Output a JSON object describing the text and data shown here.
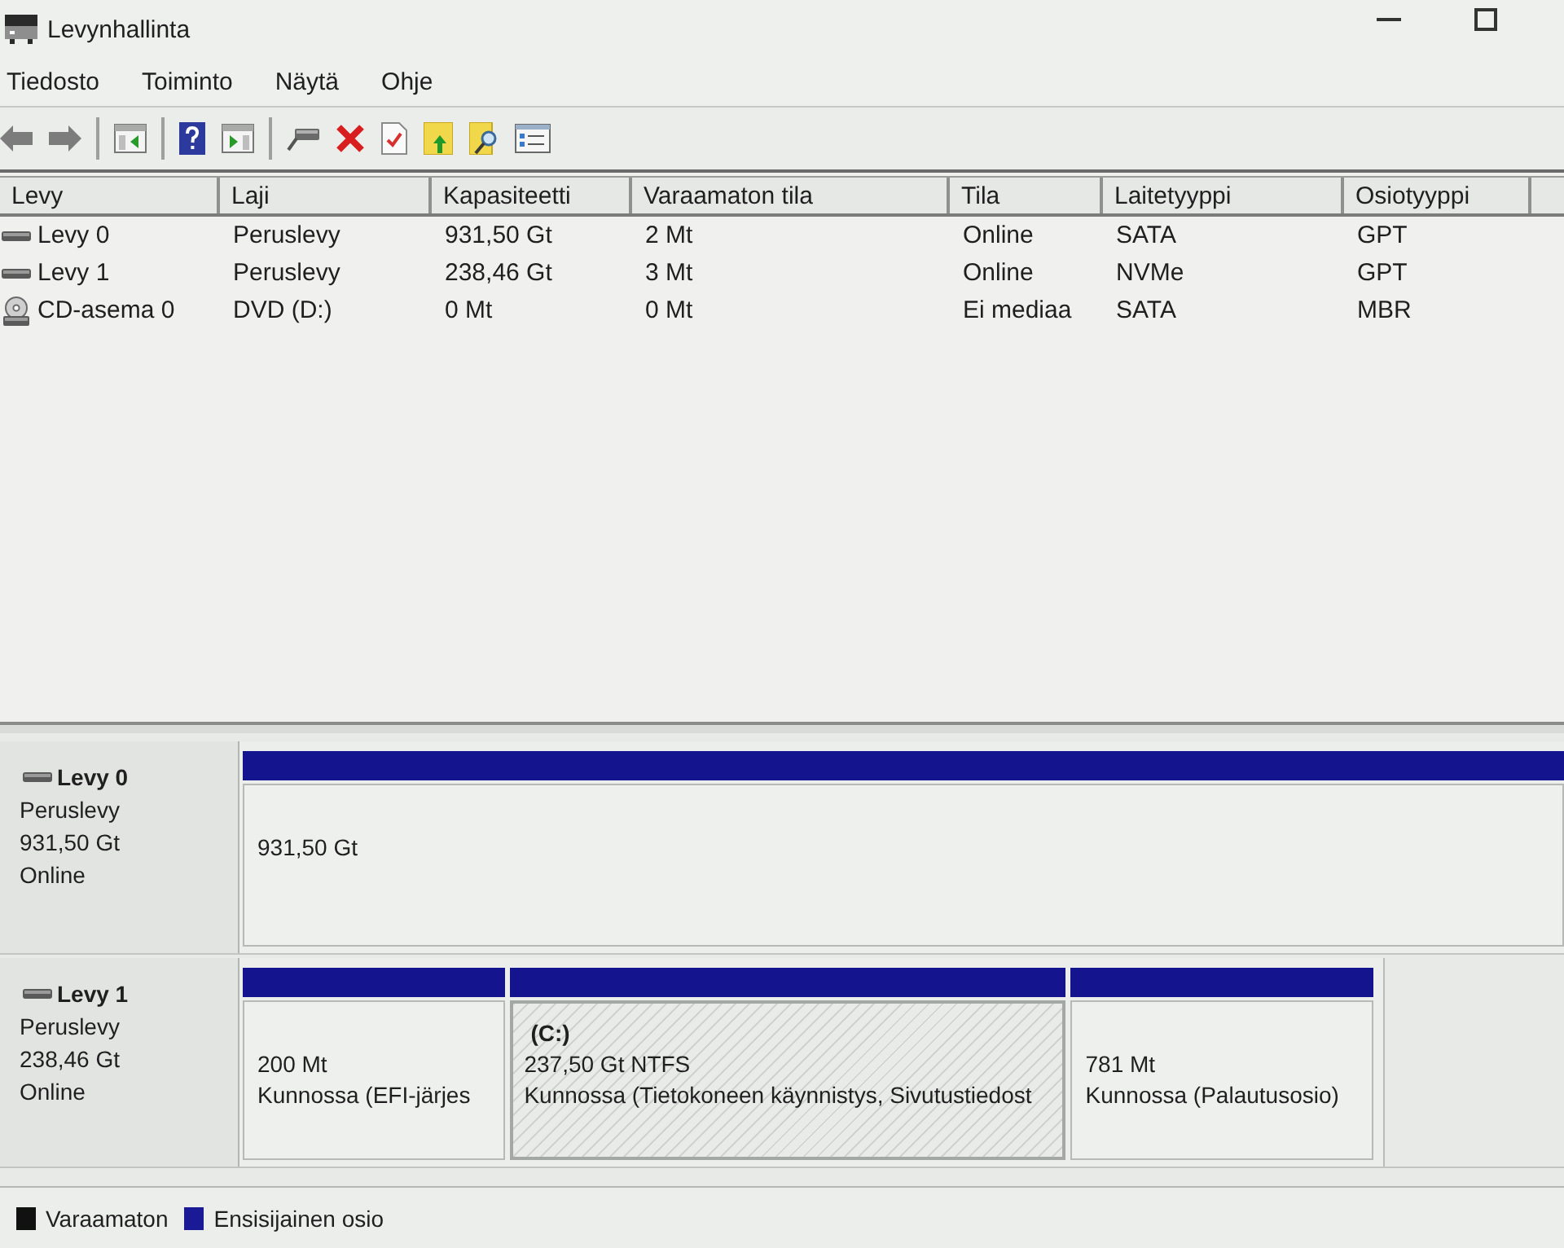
{
  "window": {
    "title": "Levynhallinta"
  },
  "menu": [
    {
      "label": "Tiedosto"
    },
    {
      "label": "Toiminto"
    },
    {
      "label": "Näytä"
    },
    {
      "label": "Ohje"
    }
  ],
  "volume_list": {
    "columns": [
      "Levy",
      "Laji",
      "Kapasiteetti",
      "Varaamaton tila",
      "Tila",
      "Laitetyyppi",
      "Osiotyyppi"
    ],
    "rows": [
      {
        "kind": "disk",
        "cells": [
          "Levy 0",
          "Peruslevy",
          "931,50 Gt",
          "2 Mt",
          "Online",
          "SATA",
          "GPT"
        ]
      },
      {
        "kind": "disk",
        "cells": [
          "Levy 1",
          "Peruslevy",
          "238,46 Gt",
          "3 Mt",
          "Online",
          "NVMe",
          "GPT"
        ]
      },
      {
        "kind": "cd",
        "cells": [
          "CD-asema 0",
          "DVD (D:)",
          "0 Mt",
          "0 Mt",
          "Ei mediaa",
          "SATA",
          "MBR"
        ]
      }
    ]
  },
  "disks": [
    {
      "name": "Levy 0",
      "type": "Peruslevy",
      "size": "931,50 Gt",
      "status": "Online",
      "partitions": [
        {
          "size": "931,50 Gt",
          "selected": false
        }
      ]
    },
    {
      "name": "Levy 1",
      "type": "Peruslevy",
      "size": "238,46 Gt",
      "status": "Online",
      "partitions": [
        {
          "size": "200 Mt",
          "status": "Kunnossa (EFI-järjes",
          "selected": false
        },
        {
          "label": "(C:)",
          "size": "237,50 Gt NTFS",
          "status": "Kunnossa (Tietokoneen käynnistys, Sivutustiedost",
          "selected": true
        },
        {
          "size": "781 Mt",
          "status": "Kunnossa (Palautusosio)",
          "selected": false
        }
      ]
    }
  ],
  "legend": [
    {
      "label": "Varaamaton",
      "color": "#111111"
    },
    {
      "label": "Ensisijainen osio",
      "color": "#1a1a96"
    }
  ]
}
